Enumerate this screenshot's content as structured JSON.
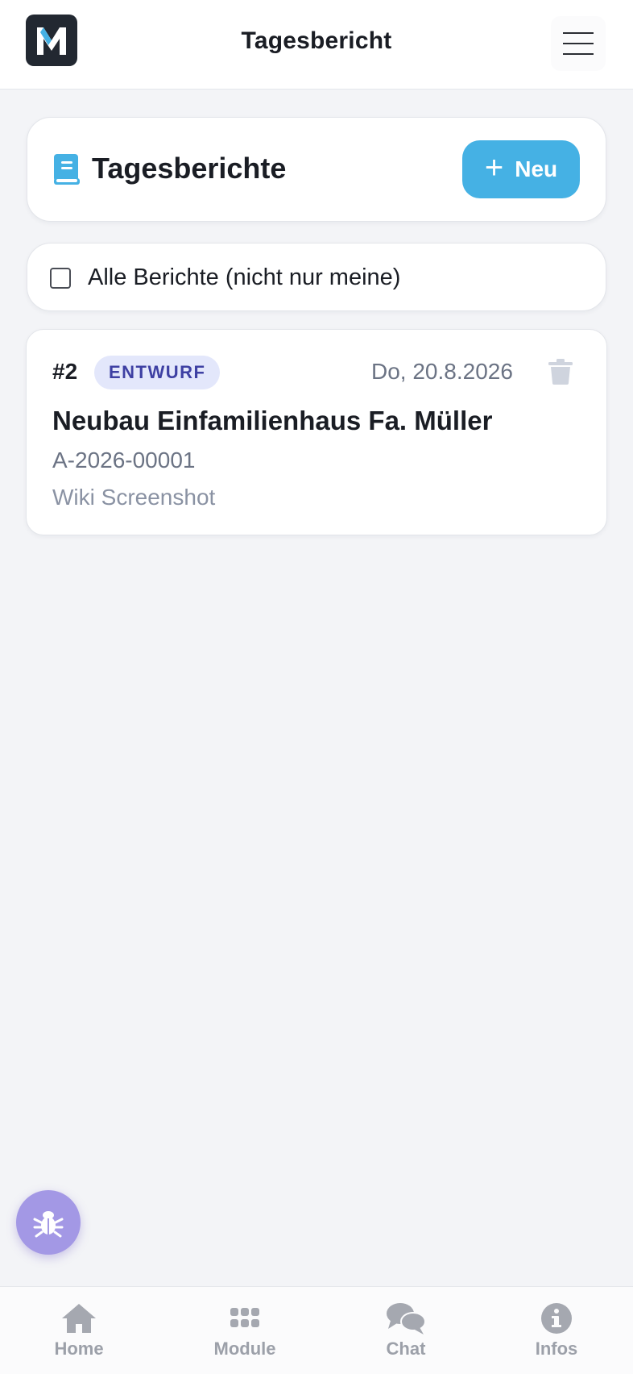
{
  "app": {
    "logo_letter": "M",
    "title": "Tagesbericht"
  },
  "header": {
    "title": "Tagesberichte",
    "new_button_plus": "+",
    "new_button_label": "Neu"
  },
  "filter": {
    "checkbox_label": "Alle Berichte (nicht nur meine)",
    "checked": false
  },
  "reports": [
    {
      "number": "#2",
      "status": "ENTWURF",
      "date": "Do, 20.8.2026",
      "title": "Neubau Einfamilienhaus Fa. Müller",
      "project_id": "A-2026-00001",
      "subtitle": "Wiki Screenshot"
    }
  ],
  "bottom_nav": [
    {
      "label": "Home",
      "icon": "home-icon"
    },
    {
      "label": "Module",
      "icon": "grid-icon"
    },
    {
      "label": "Chat",
      "icon": "chat-icon"
    },
    {
      "label": "Infos",
      "icon": "info-icon"
    }
  ],
  "colors": {
    "accent": "#45b1e4",
    "badge_bg": "#e3e7fb",
    "badge_text": "#3e40a3",
    "bug_button": "#a398e5",
    "background": "#f3f4f7"
  }
}
